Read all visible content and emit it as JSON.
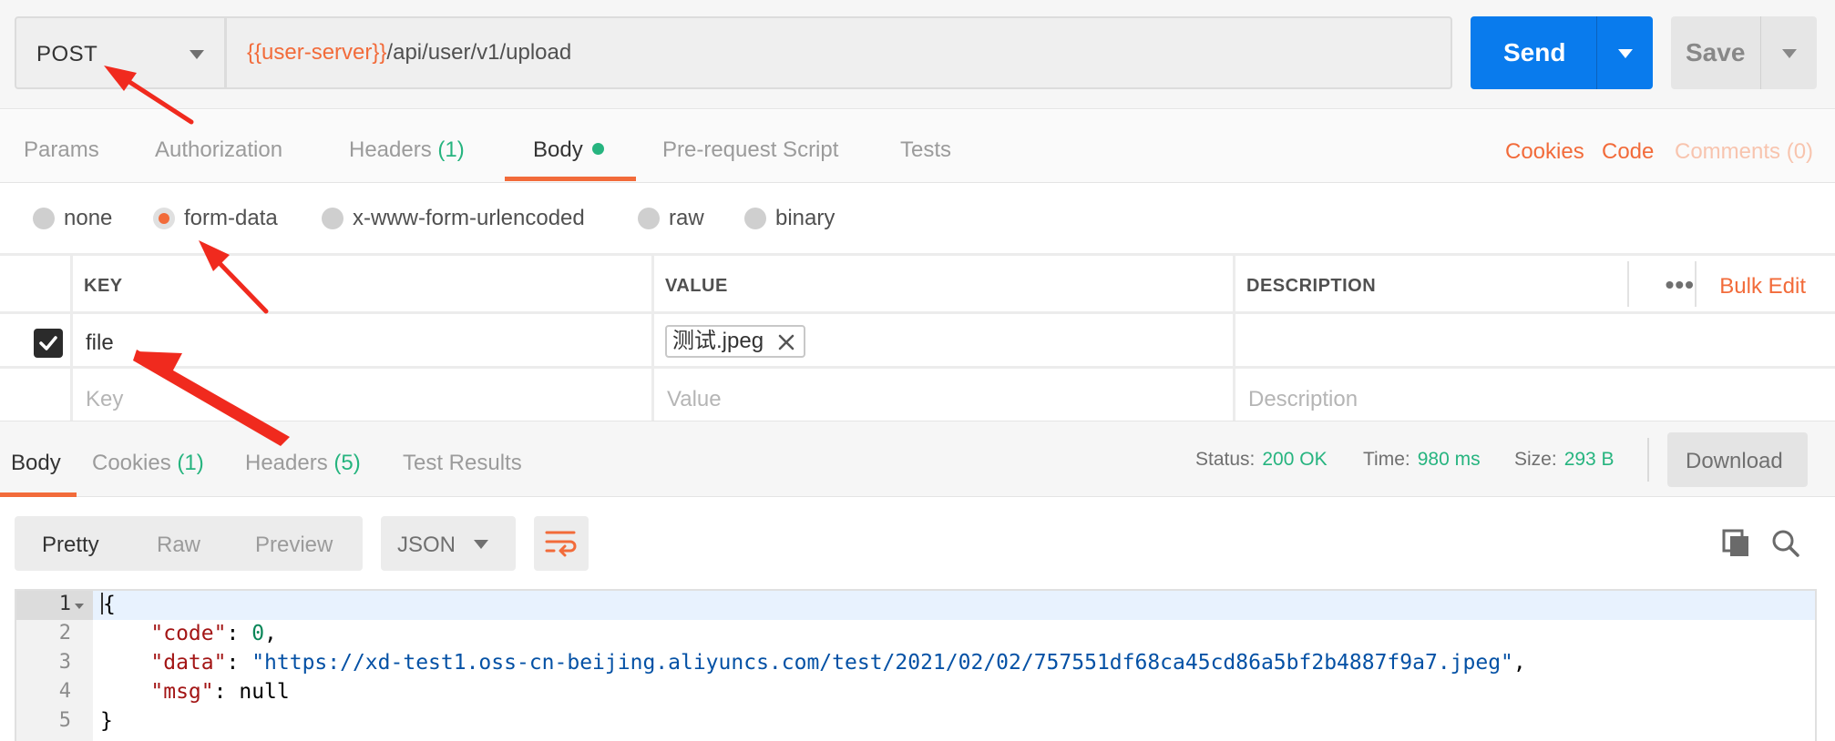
{
  "request": {
    "method": "POST",
    "url_variable": "{{user-server}}",
    "url_path": "/api/user/v1/upload",
    "send_label": "Send",
    "save_label": "Save"
  },
  "request_tabs": [
    {
      "label": "Params",
      "count": ""
    },
    {
      "label": "Authorization",
      "count": ""
    },
    {
      "label": "Headers",
      "count": "(1)"
    },
    {
      "label": "Body",
      "count": "",
      "active": true
    },
    {
      "label": "Pre-request Script",
      "count": ""
    },
    {
      "label": "Tests",
      "count": ""
    }
  ],
  "request_links": {
    "cookies": "Cookies",
    "code": "Code",
    "comments": "Comments (0)"
  },
  "body_types": [
    {
      "label": "none",
      "selected": false
    },
    {
      "label": "form-data",
      "selected": true
    },
    {
      "label": "x-www-form-urlencoded",
      "selected": false
    },
    {
      "label": "raw",
      "selected": false
    },
    {
      "label": "binary",
      "selected": false
    }
  ],
  "params_table": {
    "headers": {
      "key": "KEY",
      "value": "VALUE",
      "description": "DESCRIPTION"
    },
    "more_icon": "ellipsis-icon",
    "bulk_edit": "Bulk Edit",
    "rows": [
      {
        "checked": true,
        "key": "file",
        "value_file": "测试.jpeg",
        "description": ""
      }
    ],
    "placeholders": {
      "key": "Key",
      "value": "Value",
      "description": "Description"
    }
  },
  "response_tabs": [
    {
      "label": "Body",
      "count": "",
      "active": true
    },
    {
      "label": "Cookies",
      "count": "(1)"
    },
    {
      "label": "Headers",
      "count": "(5)"
    },
    {
      "label": "Test Results",
      "count": ""
    }
  ],
  "response_stats": {
    "status_label": "Status:",
    "status_value": "200 OK",
    "time_label": "Time:",
    "time_value": "980 ms",
    "size_label": "Size:",
    "size_value": "293 B"
  },
  "download_label": "Download",
  "view_modes": [
    {
      "label": "Pretty",
      "active": true
    },
    {
      "label": "Raw",
      "active": false
    },
    {
      "label": "Preview",
      "active": false
    }
  ],
  "format": "JSON",
  "icons": {
    "wrap": "wrap-lines-icon",
    "copy": "copy-icon",
    "search": "search-icon",
    "remove_file": "close-icon",
    "check": "check-icon"
  },
  "code_lines": {
    "n1": "1",
    "n2": "2",
    "n3": "3",
    "n4": "4",
    "n5": "5",
    "open_brace": "{",
    "code_key": "\"code\"",
    "code_val": "0",
    "data_key": "\"data\"",
    "data_val": "\"https://xd-test1.oss-cn-beijing.aliyuncs.com/test/2021/02/02/757551df68ca45cd86a5bf2b4887f9a7.jpeg\"",
    "msg_key": "\"msg\"",
    "msg_val": "null",
    "close_brace": "}"
  },
  "colors": {
    "accent": "#f26b3a",
    "send_blue": "#097bed",
    "count_green": "#26b47f",
    "arrow_red": "#f02a1e"
  }
}
